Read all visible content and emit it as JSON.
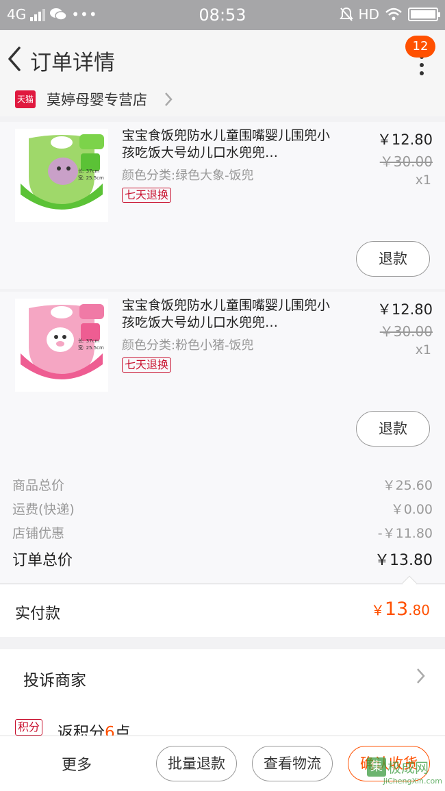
{
  "status_bar": {
    "network": "4G",
    "time": "08:53",
    "hd": "HD"
  },
  "nav": {
    "title": "订单详情",
    "badge_count": "12",
    "back_icon": "back-arrow-icon",
    "more_icon": "more-vertical-icon"
  },
  "store": {
    "tmall_label": "天猫",
    "name": "莫婷母婴专营店"
  },
  "items": [
    {
      "name": "宝宝食饭兜防水儿童围嘴婴儿围兜小孩吃饭大号幼儿口水兜兜…",
      "sku": "颜色分类:绿色大象-饭兜",
      "tag": "七天退换",
      "price": "￥12.80",
      "original_price": "￥30.00",
      "quantity": "x1",
      "refund_label": "退款",
      "color": "#7cd34a"
    },
    {
      "name": "宝宝食饭兜防水儿童围嘴婴儿围兜小孩吃饭大号幼儿口水兜兜…",
      "sku": "颜色分类:粉色小猪-饭兜",
      "tag": "七天退换",
      "price": "￥12.80",
      "original_price": "￥30.00",
      "quantity": "x1",
      "refund_label": "退款",
      "color": "#f07aa6"
    }
  ],
  "summary": {
    "goods_total_label": "商品总价",
    "goods_total": "￥25.60",
    "shipping_label": "运费(快递)",
    "shipping": "￥0.00",
    "discount_label": "店铺优惠",
    "discount": "-￥11.80",
    "order_total_label": "订单总价",
    "order_total": "￥13.80"
  },
  "paid": {
    "label": "实付款",
    "currency": "￥",
    "amount_int": "13",
    "amount_dec": ".80"
  },
  "complain": {
    "label": "投诉商家"
  },
  "points": {
    "tag": "积分",
    "text_prefix": "返积分",
    "value": "6",
    "text_suffix": "点"
  },
  "bottom_bar": {
    "more": "更多",
    "batch_refund": "批量退款",
    "logistics": "查看物流",
    "confirm": "确认收货"
  },
  "watermark": {
    "main": "极成网",
    "sub": "JiChengXin.com"
  },
  "colors": {
    "accent": "#ff5000",
    "tmall_red": "#e0193f"
  }
}
